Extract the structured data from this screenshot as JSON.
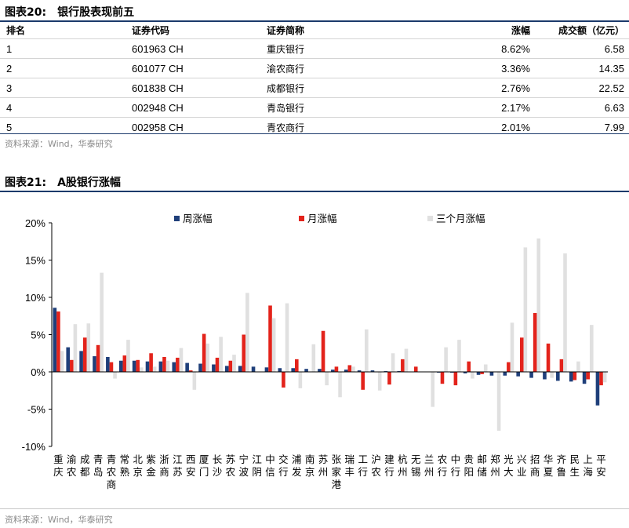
{
  "table_section": {
    "caption_label": "图表20:",
    "caption_title": "银行股表现前五",
    "headers": [
      "排名",
      "证券代码",
      "证券简称",
      "涨幅",
      "成交额（亿元）"
    ],
    "rows": [
      [
        "1",
        "601963 CH",
        "重庆银行",
        "8.62%",
        "6.58"
      ],
      [
        "2",
        "601077 CH",
        "渝农商行",
        "3.36%",
        "14.35"
      ],
      [
        "3",
        "601838 CH",
        "成都银行",
        "2.76%",
        "22.52"
      ],
      [
        "4",
        "002948 CH",
        "青岛银行",
        "2.17%",
        "6.63"
      ],
      [
        "5",
        "002958 CH",
        "青农商行",
        "2.01%",
        "7.99"
      ]
    ],
    "source": "资料来源：Wind，华泰研究"
  },
  "chart_section": {
    "caption_label": "图表21:",
    "caption_title": "A股银行涨幅",
    "source": "资料来源：Wind，华泰研究"
  },
  "chart_data": {
    "type": "bar",
    "categories": [
      "重庆",
      "渝农",
      "成都",
      "青岛",
      "青农商",
      "常熟",
      "北京",
      "紫金",
      "浙商",
      "江苏",
      "西安",
      "厦门",
      "长沙",
      "苏农",
      "宁波",
      "江阴",
      "中信",
      "交行",
      "浦发",
      "南京",
      "苏州",
      "张家港",
      "瑞丰",
      "工行",
      "沪农",
      "建行",
      "杭州",
      "无锡",
      "兰州",
      "农行",
      "中行",
      "贵阳",
      "邮储",
      "郑州",
      "光大",
      "兴业",
      "招商",
      "华夏",
      "齐鲁",
      "民生",
      "上海",
      "平安"
    ],
    "series": [
      {
        "name": "周涨幅",
        "color": "#1f3f7a",
        "values": [
          8.6,
          3.3,
          2.8,
          2.1,
          2.0,
          1.5,
          1.5,
          1.4,
          1.4,
          1.3,
          1.2,
          1.1,
          1.0,
          0.8,
          0.8,
          0.7,
          0.6,
          0.5,
          0.5,
          0.4,
          0.4,
          0.3,
          0.3,
          0.2,
          0.2,
          0.1,
          0.1,
          0.0,
          0.0,
          -0.1,
          -0.1,
          -0.2,
          -0.4,
          -0.5,
          -0.5,
          -0.6,
          -0.8,
          -1.0,
          -1.2,
          -1.3,
          -1.6,
          -4.5
        ]
      },
      {
        "name": "月涨幅",
        "color": "#e3231b",
        "values": [
          8.1,
          1.6,
          4.6,
          3.6,
          1.3,
          2.2,
          1.6,
          2.5,
          2.0,
          1.9,
          0.2,
          5.1,
          1.9,
          1.5,
          5.0,
          0.0,
          8.9,
          -2.1,
          1.7,
          0.0,
          5.5,
          0.7,
          0.9,
          -2.4,
          0.0,
          -1.7,
          1.7,
          0.7,
          0.0,
          -1.6,
          -1.8,
          1.4,
          -0.3,
          0.0,
          1.3,
          4.6,
          7.9,
          3.8,
          1.7,
          -1.1,
          -1.0,
          -1.8
        ]
      },
      {
        "name": "三个月涨幅",
        "color": "#e0e0e0",
        "values": [
          2.8,
          6.4,
          6.5,
          13.3,
          -0.9,
          4.3,
          0.6,
          0.7,
          1.5,
          3.2,
          -2.4,
          3.8,
          4.7,
          2.3,
          10.6,
          0.0,
          7.2,
          9.2,
          -2.2,
          3.7,
          -1.8,
          -3.4,
          0.7,
          5.7,
          -2.5,
          2.5,
          3.1,
          0.0,
          -4.7,
          3.3,
          4.3,
          -0.9,
          1.0,
          -7.9,
          6.6,
          16.7,
          17.9,
          -0.8,
          15.9,
          1.4,
          6.3,
          -1.4
        ]
      }
    ],
    "yticks": [
      "20%",
      "15%",
      "10%",
      "5%",
      "0%",
      "-5%",
      "-10%"
    ],
    "ylim": [
      -10,
      20
    ],
    "grid": false,
    "legend_position": "top"
  }
}
